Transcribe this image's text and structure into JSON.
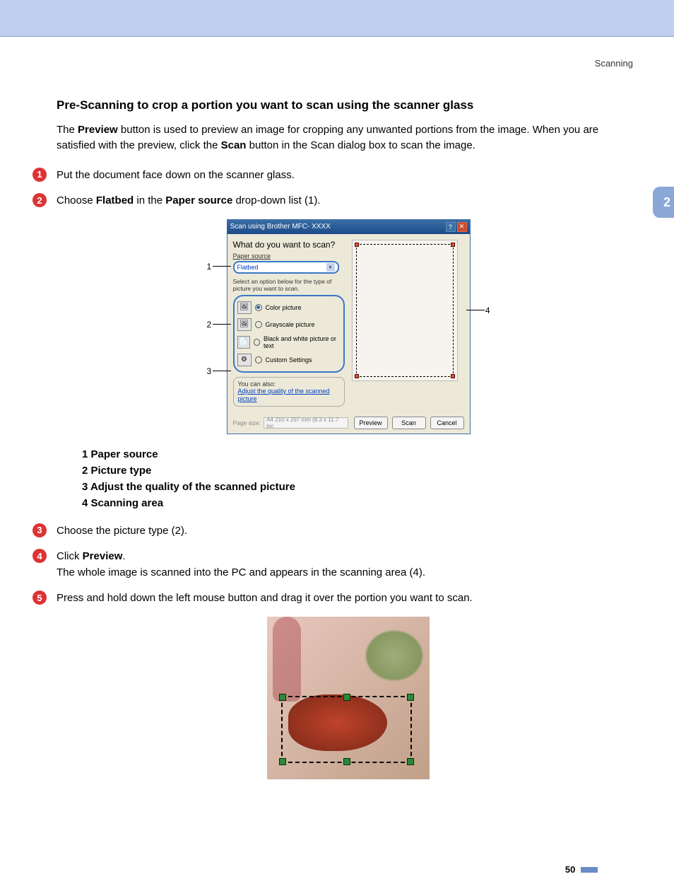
{
  "header_right": "Scanning",
  "side_tab": "2",
  "title": "Pre-Scanning to crop a portion you want to scan using the scanner glass",
  "intro_a": "The ",
  "intro_b": "Preview",
  "intro_c": " button is used to preview an image for cropping any unwanted portions from the image. When you are satisfied with the preview, click the ",
  "intro_d": "Scan",
  "intro_e": " button in the Scan dialog box to scan the image.",
  "step1": "Put the document face down on the scanner glass.",
  "step2_a": "Choose ",
  "step2_b": "Flatbed",
  "step2_c": " in the ",
  "step2_d": "Paper source",
  "step2_e": " drop-down list (1).",
  "step3": "Choose the picture type (2).",
  "step4_a": "Click ",
  "step4_b": "Preview",
  "step4_c": ".",
  "step4_d": "The whole image is scanned into the PC and appears in the scanning area (4).",
  "step5": "Press and hold down the left mouse button and drag it over the portion you want to scan.",
  "legend": {
    "l1": "1   Paper source",
    "l2": "2   Picture type",
    "l3": "3   Adjust the quality of the scanned picture",
    "l4": "4   Scanning area"
  },
  "dialog": {
    "title": "Scan using Brother MFC- XXXX",
    "question": "What do you want to scan?",
    "paper_label": "Paper source",
    "paper_value": "Flatbed",
    "hint": "Select an option below for the type of picture you want to scan.",
    "opt_color": "Color picture",
    "opt_gray": "Grayscale picture",
    "opt_bw": "Black and white picture or text",
    "opt_custom": "Custom Settings",
    "also_label": "You can also:",
    "also_link": "Adjust the quality of the scanned picture",
    "page_size_label": "Page size:",
    "page_size_value": "A4 210 x 297 mm (8.3 x 11.7 inc",
    "btn_preview": "Preview",
    "btn_scan": "Scan",
    "btn_cancel": "Cancel"
  },
  "callouts": {
    "c1": "1",
    "c2": "2",
    "c3": "3",
    "c4": "4"
  },
  "page_number": "50"
}
